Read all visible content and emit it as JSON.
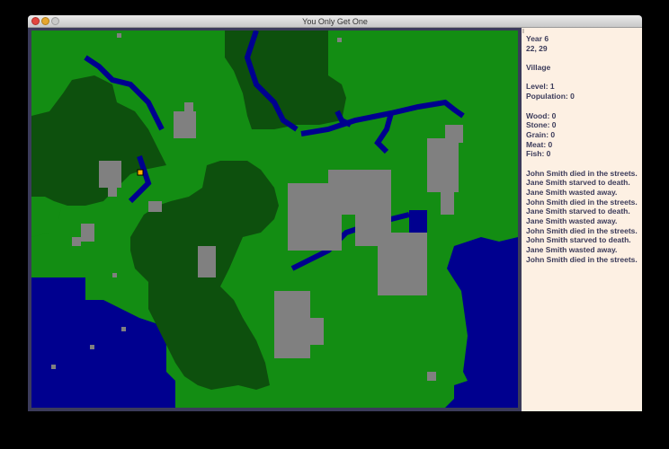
{
  "window": {
    "title": "You Only Get One"
  },
  "status": {
    "year": "Year 6",
    "coords": "22, 29",
    "place": "Village",
    "level": "Level: 1",
    "population": "Population: 0"
  },
  "resources": [
    "Wood: 0",
    "Stone: 0",
    "Grain: 0",
    "Meat: 0",
    "Fish: 0"
  ],
  "log": [
    "John Smith died in the streets.",
    "Jane Smith starved to death.",
    "Jane Smith wasted away.",
    "John Smith died in the streets.",
    "Jane Smith starved to death.",
    "Jane Smith wasted away.",
    "John Smith died in the streets.",
    "John Smith starved to death.",
    "Jane Smith wasted away.",
    "John Smith died in the streets."
  ],
  "colors": {
    "water": "#00008f",
    "grass": "#138d13",
    "forest": "#0d500d",
    "stone": "#808080",
    "cursor": "#ffae00",
    "panel_bg": "#fdf0e3",
    "panel_text": "#3b3b5a"
  }
}
